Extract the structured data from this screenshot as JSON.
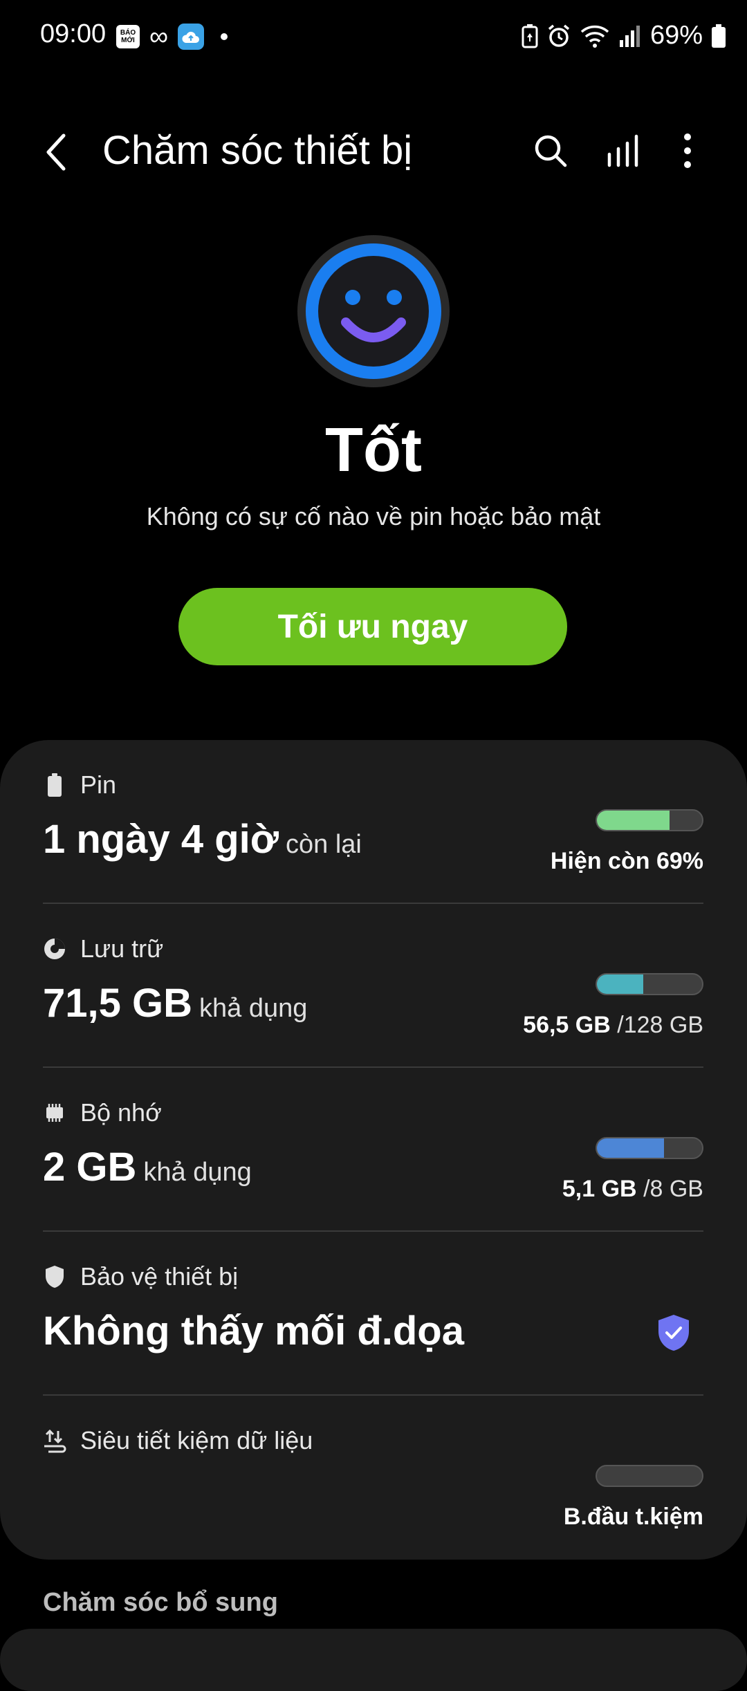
{
  "status_bar": {
    "time": "09:00",
    "notification_badge": "BÁO MỚI",
    "battery_percent": "69%",
    "icons": [
      "baomoi-app-icon",
      "loop-icon",
      "cloud-upload-icon",
      "notification-dot",
      "battery-saver-icon",
      "alarm-icon",
      "wifi-icon",
      "signal-icon",
      "battery-icon"
    ]
  },
  "app_bar": {
    "title": "Chăm sóc thiết bị",
    "icons": [
      "back-icon",
      "search-icon",
      "report-chart-icon",
      "more-vert-icon"
    ]
  },
  "overview": {
    "status_word": "Tốt",
    "description": "Không có sự cố nào về pin hoặc bảo mật",
    "optimize_label": "Tối ưu ngay",
    "accent_color": "#6cc11f",
    "face_ring_color": "#1a7ef0"
  },
  "items": {
    "battery": {
      "label": "Pin",
      "value_big": "1 ngày 4 giờ",
      "value_small": "còn lại",
      "right_text": "Hiện còn 69%",
      "level": 0.69,
      "color": "#7fd88c"
    },
    "storage": {
      "label": "Lưu trữ",
      "value_big": "71,5 GB",
      "value_small": "khả dụng",
      "used": "56,5 GB",
      "total": "/128 GB",
      "level": 0.44,
      "color": "#4bb3bf"
    },
    "memory": {
      "label": "Bộ nhớ",
      "value_big": "2 GB",
      "value_small": "khả dụng",
      "used": "5,1 GB",
      "total": "/8 GB",
      "level": 0.64,
      "color": "#4d86d6"
    },
    "protection": {
      "label": "Bảo vệ thiết bị",
      "value_big": "Không thấy mối đ.dọa",
      "shield_color": "#6f74f2"
    },
    "data_saver": {
      "label": "Siêu tiết kiệm dữ liệu",
      "right_text": "B.đầu t.kiệm",
      "level": 0
    }
  },
  "section": {
    "title": "Chăm sóc bổ sung"
  }
}
